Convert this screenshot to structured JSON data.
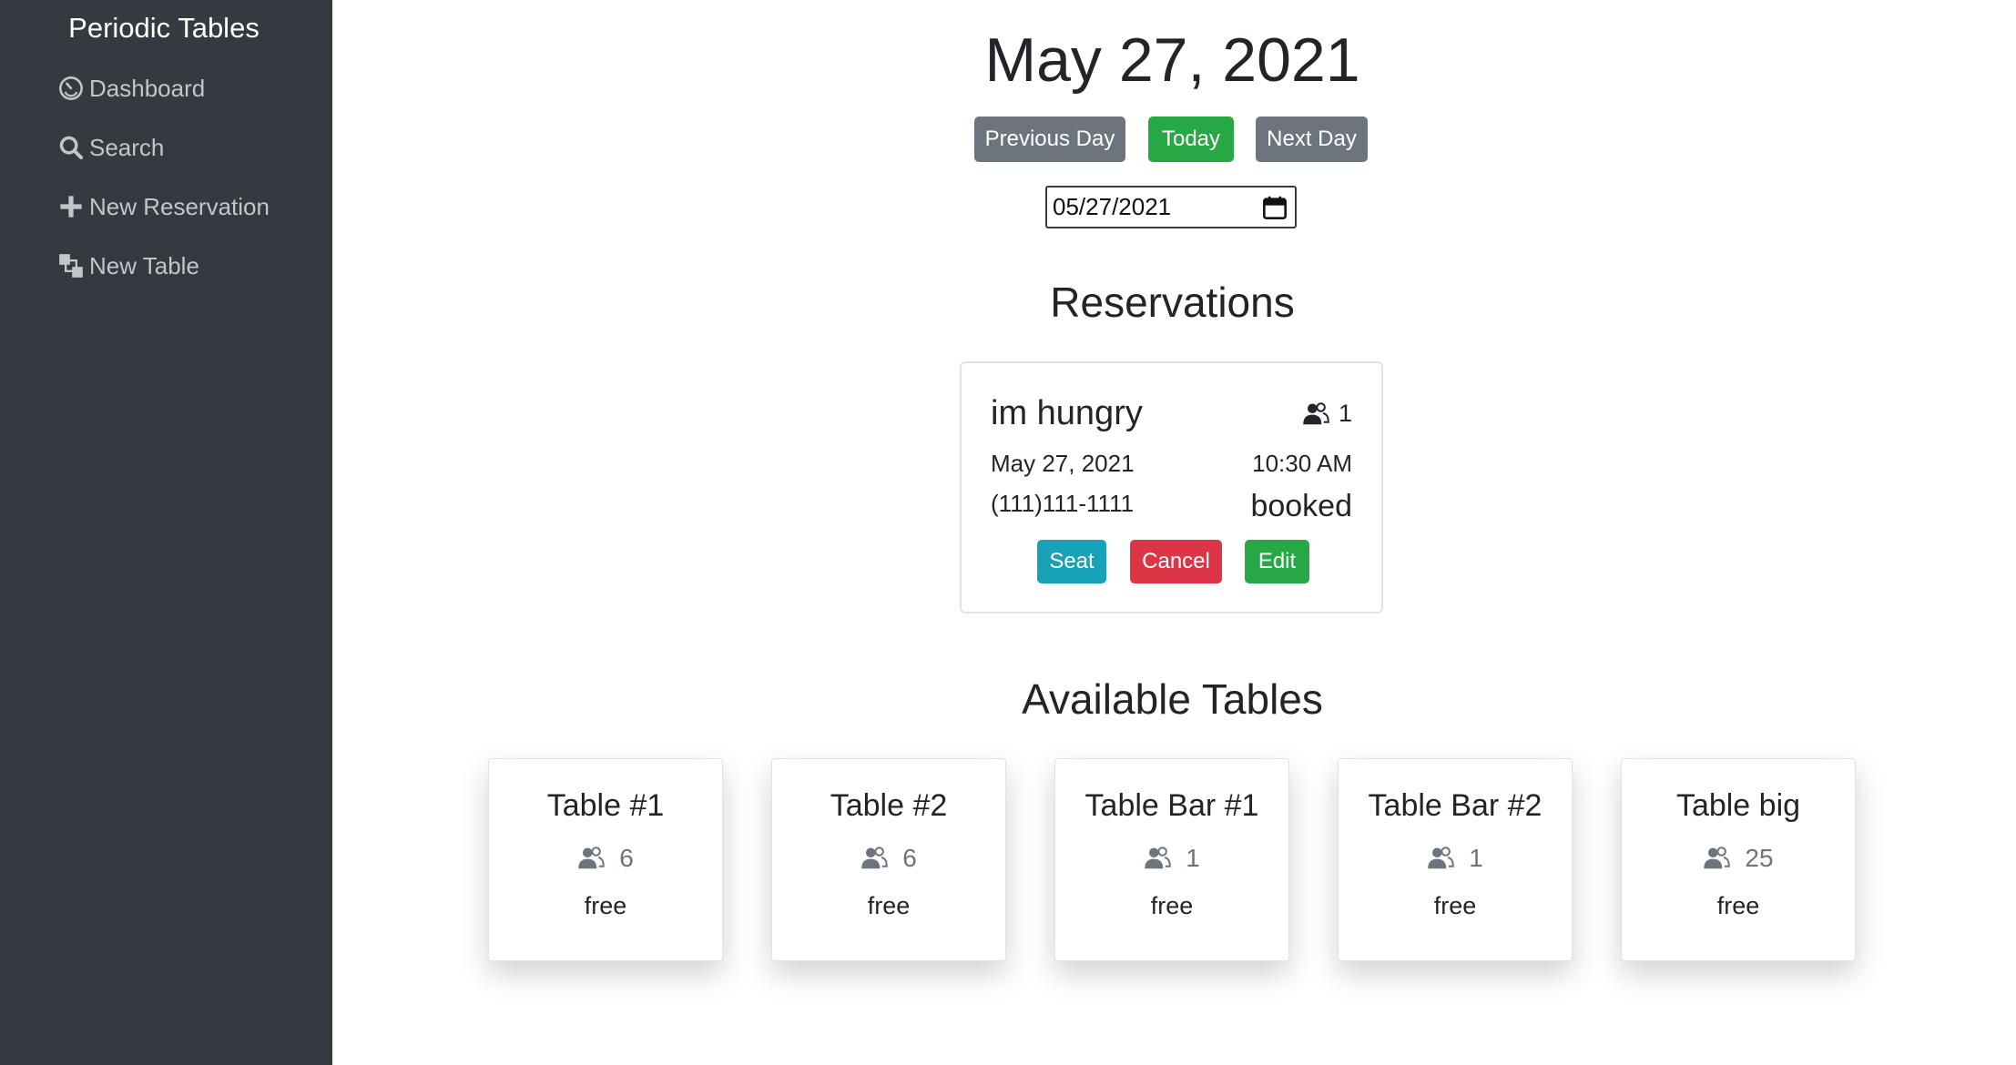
{
  "sidebar": {
    "brand": "Periodic Tables",
    "items": [
      {
        "label": "Dashboard",
        "icon": "dashboard-icon"
      },
      {
        "label": "Search",
        "icon": "search-icon"
      },
      {
        "label": "New Reservation",
        "icon": "plus-icon"
      },
      {
        "label": "New Table",
        "icon": "layers-icon"
      }
    ]
  },
  "header": {
    "date_title": "May 27, 2021",
    "previous_label": "Previous Day",
    "today_label": "Today",
    "next_label": "Next Day",
    "date_input_value": "05/27/2021"
  },
  "reservations": {
    "title": "Reservations",
    "items": [
      {
        "name": "im hungry",
        "people": "1",
        "date": "May 27, 2021",
        "time": "10:30 AM",
        "phone": "(111)111-1111",
        "status": "booked",
        "seat_label": "Seat",
        "cancel_label": "Cancel",
        "edit_label": "Edit"
      }
    ]
  },
  "tables": {
    "title": "Available Tables",
    "items": [
      {
        "name": "Table #1",
        "capacity": "6",
        "status": "free"
      },
      {
        "name": "Table #2",
        "capacity": "6",
        "status": "free"
      },
      {
        "name": "Table Bar #1",
        "capacity": "1",
        "status": "free"
      },
      {
        "name": "Table Bar #2",
        "capacity": "1",
        "status": "free"
      },
      {
        "name": "Table big",
        "capacity": "25",
        "status": "free"
      }
    ]
  },
  "colors": {
    "sidebar_bg": "#343a40",
    "secondary": "#6c757d",
    "success": "#28a745",
    "info": "#17a2b8",
    "danger": "#dc3545"
  }
}
